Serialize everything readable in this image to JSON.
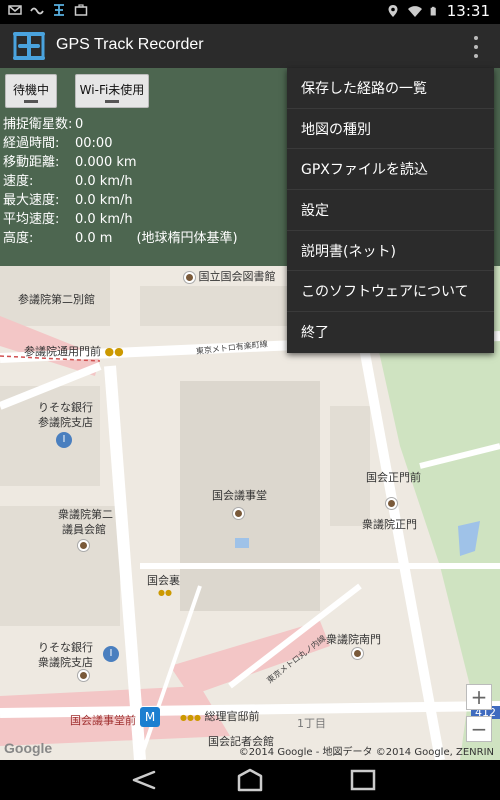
{
  "status_bar": {
    "time": "13:31",
    "left_icons": [
      "mail-icon",
      "signal-tilde-icon",
      "app-icon",
      "briefcase-icon"
    ],
    "right_icons": [
      "location-icon",
      "wifi-icon",
      "battery-icon"
    ]
  },
  "action_bar": {
    "title": "GPS Track Recorder"
  },
  "panel": {
    "button_wait": "待機中",
    "button_wifi": "Wi-Fi未使用",
    "stats": [
      {
        "label": "捕捉衛星数:",
        "value": "0",
        "note": ""
      },
      {
        "label": "経過時間:",
        "value": "00:00",
        "note": ""
      },
      {
        "label": "移動距離:",
        "value": "0.000 km",
        "note": ""
      },
      {
        "label": "速度:",
        "value": "0.0 km/h",
        "note": ""
      },
      {
        "label": "最大速度:",
        "value": "0.0 km/h",
        "note": ""
      },
      {
        "label": "平均速度:",
        "value": "0.0 km/h",
        "note": ""
      },
      {
        "label": "高度:",
        "value": "0.0 m",
        "note": "(地球楕円体基準)"
      }
    ]
  },
  "menu": {
    "items": [
      "保存した経路の一覧",
      "地図の種別",
      "GPXファイルを読込",
      "設定",
      "説明書(ネット)",
      "このソフトウェアについて",
      "終了"
    ]
  },
  "map": {
    "labels": {
      "library": "国立国会図書館",
      "annex2": "参議院第二別館",
      "gate_sangiin": "参議院通用門前",
      "metro_yurakucho": "東京メトロ有楽町線",
      "resona1_a": "りそな銀行",
      "resona1_b": "参議院支店",
      "diet_building": "国会議事堂",
      "seimon": "国会正門前",
      "shugiin_seimon": "衆議院正門",
      "shugiin_kaikan_a": "衆議院第二",
      "shugiin_kaikan_b": "議員会館",
      "kokkaiura": "国会裏",
      "shugiin_minamimon": "衆議院南門",
      "metro_marunouchi": "東京メトロ丸ノ内線",
      "resona2_a": "りそな銀行",
      "resona2_b": "衆議院支店",
      "station": "国会議事堂前",
      "kantei": "総理官邸前",
      "itchome": "1丁目",
      "kisha": "国会記者会館",
      "route_num": "412",
      "google": "Google",
      "copyright": "©2014 Google - 地図データ ©2014 Google, ZENRIN",
      "zoom_in": "+",
      "zoom_out": "−"
    }
  },
  "nav_bar": {
    "icons": [
      "back-icon",
      "home-icon",
      "recents-icon"
    ]
  }
}
